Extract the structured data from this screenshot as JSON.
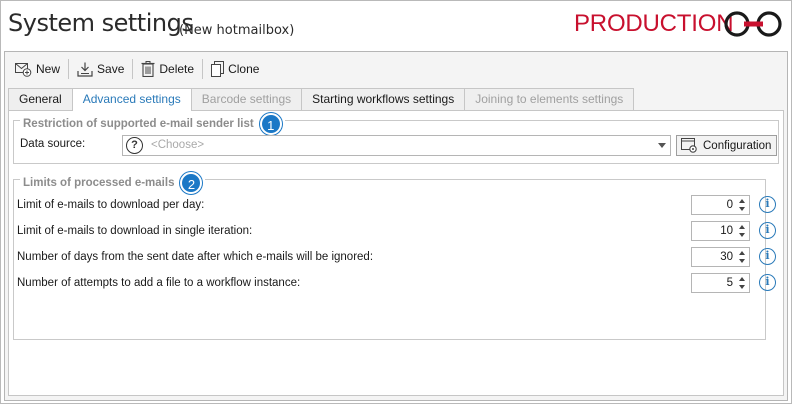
{
  "window": {
    "title": "System settings",
    "subtitle": "(New hotmailbox)",
    "environment": "PRODUCTION",
    "environment_color": "#c8102e"
  },
  "toolbar": {
    "new_label": "New",
    "save_label": "Save",
    "delete_label": "Delete",
    "clone_label": "Clone"
  },
  "tabs": [
    {
      "label": "General",
      "state": "normal"
    },
    {
      "label": "Advanced settings",
      "state": "active"
    },
    {
      "label": "Barcode settings",
      "state": "disabled"
    },
    {
      "label": "Starting workflows settings",
      "state": "normal"
    },
    {
      "label": "Joining to elements settings",
      "state": "disabled"
    }
  ],
  "sender_group": {
    "title": "Restriction of supported e-mail sender list",
    "badge": "1",
    "data_source_label": "Data source:",
    "data_source_placeholder": "<Choose>",
    "configuration_label": "Configuration"
  },
  "limits_group": {
    "title": "Limits of processed e-mails",
    "badge": "2",
    "rows": [
      {
        "label": "Limit of e-mails to download per day:",
        "value": "0"
      },
      {
        "label": "Limit of e-mails to download in single iteration:",
        "value": "10"
      },
      {
        "label": "Number of days from the sent date after which e-mails will be ignored:",
        "value": "30"
      },
      {
        "label": "Number of attempts to add a file to a workflow instance:",
        "value": "5"
      }
    ]
  },
  "colors": {
    "accent": "#2a7ab9",
    "badge": "#1b78c6"
  },
  "icons": {
    "new": "new-mail-icon",
    "save": "save-icon",
    "delete": "trash-icon",
    "clone": "clone-icon",
    "help": "help-icon",
    "config": "configuration-icon",
    "info": "info-icon"
  }
}
